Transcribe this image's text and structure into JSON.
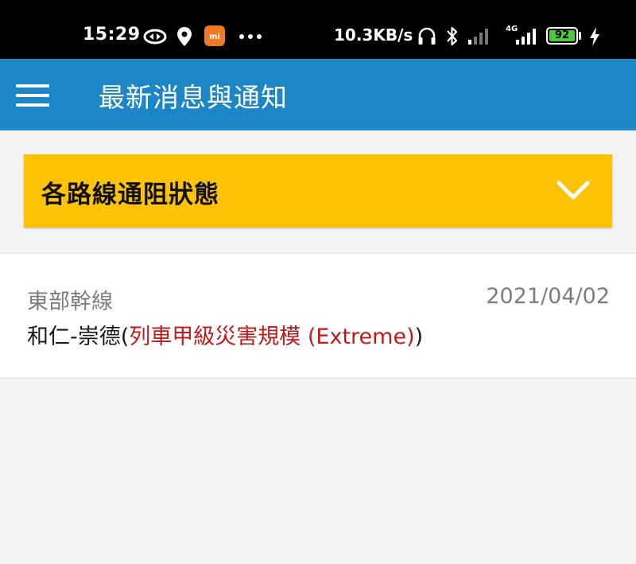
{
  "status_bar": {
    "time": "15:29",
    "net_speed": "10.3KB/s",
    "network_type": "4G",
    "battery": "92",
    "icons": [
      "sync-icon",
      "location-icon",
      "mi-app-icon",
      "more-dots-icon",
      "headset-icon",
      "bluetooth-icon",
      "signal-icon",
      "signal-4g-icon",
      "battery-icon",
      "charging-icon"
    ]
  },
  "app_bar": {
    "title": "最新消息與通知",
    "menu_icon": "hamburger-menu-icon",
    "color": "#1d86c7"
  },
  "section": {
    "title": "各路線通阻狀態",
    "toggle_icon": "chevron-down-icon",
    "color": "#fec306"
  },
  "notices": [
    {
      "line": "東部幹線",
      "date": "2021/04/02",
      "segment": "和仁-崇德",
      "paren_open": "(",
      "severity": "列車甲級災害規模 (Extreme)",
      "paren_close": ")",
      "severity_color": "#c41919"
    }
  ]
}
